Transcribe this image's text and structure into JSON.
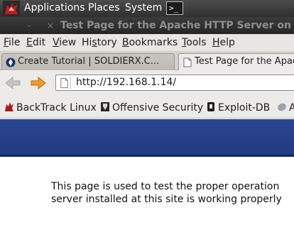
{
  "panel": {
    "menus": [
      "Applications",
      "Places",
      "System"
    ],
    "terminal_glyph": ">_",
    "logo_icon": "backtrack-dragon-icon"
  },
  "window": {
    "controls": [
      "–",
      "×"
    ],
    "title": "Test Page for the Apache HTTP Server on Fe"
  },
  "menubar": {
    "items": [
      {
        "text": "File",
        "accel": "F",
        "rest": "ile"
      },
      {
        "text": "Edit",
        "accel": "E",
        "rest": "dit"
      },
      {
        "text": "View",
        "accel": "V",
        "rest": "iew"
      },
      {
        "text": "History",
        "pre": "Hi",
        "accel": "s",
        "rest": "tory"
      },
      {
        "text": "Bookmarks",
        "accel": "B",
        "rest": "ookmarks"
      },
      {
        "text": "Tools",
        "accel": "T",
        "rest": "ools"
      },
      {
        "text": "Help",
        "accel": "H",
        "rest": "elp"
      }
    ]
  },
  "tabs": [
    {
      "label": "Create Tutorial | SOLDIERX.C...",
      "icon": "soldierx-favicon",
      "active": false
    },
    {
      "label": "Test Page for the Apac",
      "icon": "page-icon",
      "active": true
    }
  ],
  "navigation": {
    "url": "http://192.168.1.14/"
  },
  "bookmarks": [
    {
      "label": "BackTrack Linux",
      "icon": "backtrack-icon"
    },
    {
      "label": "Offensive Security",
      "icon": "offsec-icon"
    },
    {
      "label": "Exploit-DB",
      "icon": "exploitdb-icon"
    },
    {
      "label": "A",
      "icon": "aircrack-icon"
    }
  ],
  "page": {
    "line1": "This page is used to test the proper operation",
    "line2": "server installed at this site is working properly"
  },
  "colors": {
    "banner": "#223a82",
    "panel": "#3a3a3a",
    "nav_arrow": "#f09a2a"
  }
}
